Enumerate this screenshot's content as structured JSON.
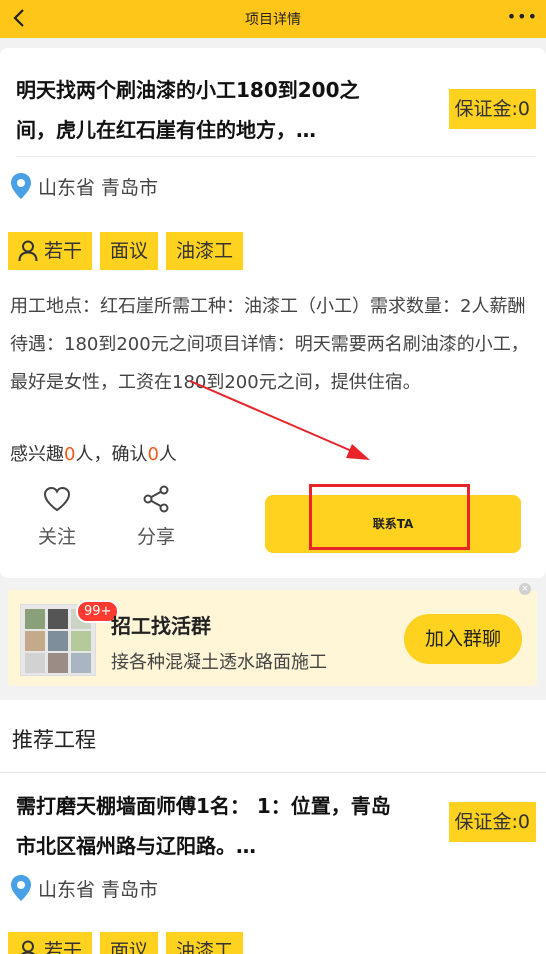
{
  "topbar": {
    "title": "项目详情",
    "more": "•••"
  },
  "project": {
    "title": "明天找两个刷油漆的小工180到200之间，虎儿在红石崖有住的地方，…",
    "deposit": "保证金:0",
    "location": "山东省 青岛市",
    "tags": [
      "若干",
      "面议",
      "油漆工"
    ],
    "description": "用工地点：红石崖所需工种：油漆工（小工）需求数量：2人薪酬待遇：180到200元之间项目详情：明天需要两名刷油漆的小工，最好是女性，工资在180到200元之间，提供住宿。",
    "interest": {
      "prefix": "感兴趣",
      "interested": "0",
      "mid": "人，确认",
      "confirmed": "0",
      "suffix": "人"
    },
    "actions": {
      "follow": "关注",
      "share": "分享",
      "contact": "联系TA"
    }
  },
  "group": {
    "badge": "99+",
    "name": "招工找活群",
    "subtitle": "接各种混凝土透水路面施工",
    "join": "加入群聊",
    "close": "×"
  },
  "recommend": {
    "heading": "推荐工程",
    "item": {
      "title": "需打磨天棚墙面师傅1名： 1：位置，青岛市北区福州路与辽阳路。…",
      "deposit": "保证金:0",
      "location": "山东省 青岛市",
      "tags": [
        "若干",
        "面议",
        "油漆工"
      ]
    }
  },
  "colors": {
    "accent": "#ffd21f",
    "topbar": "#ffc61a",
    "highlight": "#e8242a",
    "number": "#f25a1c"
  }
}
